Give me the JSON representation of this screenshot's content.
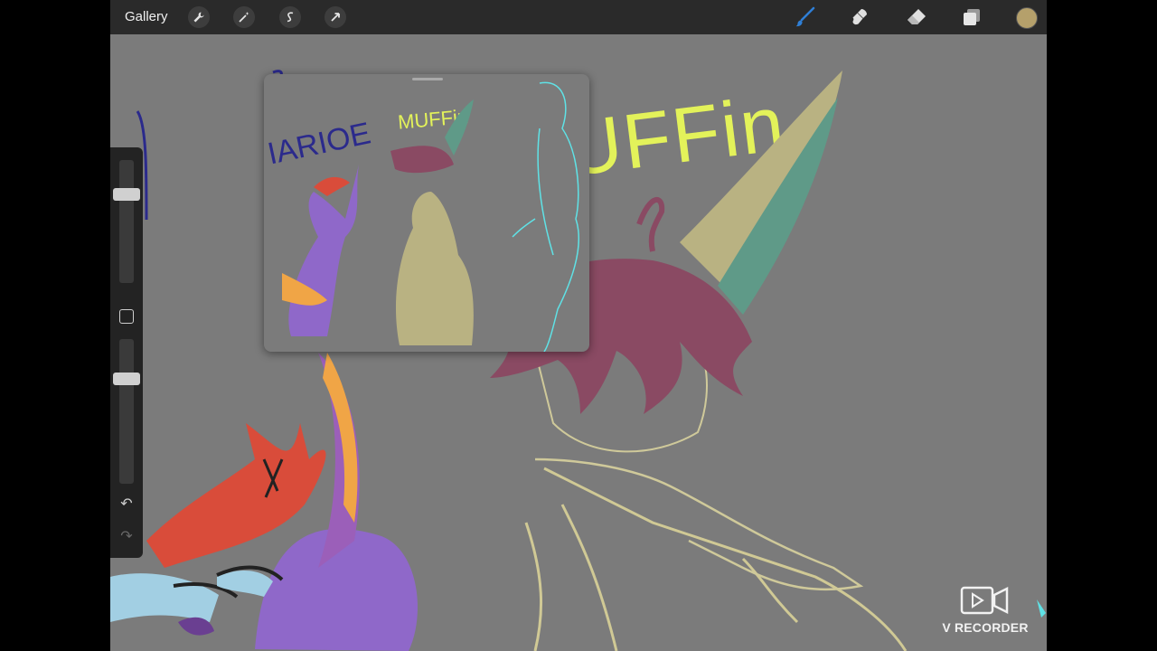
{
  "toolbar": {
    "gallery_label": "Gallery",
    "left_tools": [
      "wrench-icon",
      "magic-wand-icon",
      "selection-icon",
      "transform-arrow-icon"
    ],
    "right_tools": [
      "brush-icon",
      "smudge-icon",
      "eraser-icon",
      "layers-icon"
    ],
    "current_color": "#b5a06b",
    "active_tool_color": "#2f7fd6"
  },
  "canvas": {
    "background": "#7b7b7b",
    "title_text": "MUFFin",
    "title_color": "#e3f25a"
  },
  "reference": {
    "left_text": "IARIOE",
    "middle_text": "MUFFin"
  },
  "sidebar": {
    "brush_size_level": 0.25,
    "opacity_level": 0.25
  },
  "watermark": {
    "text": "V RECORDER"
  }
}
